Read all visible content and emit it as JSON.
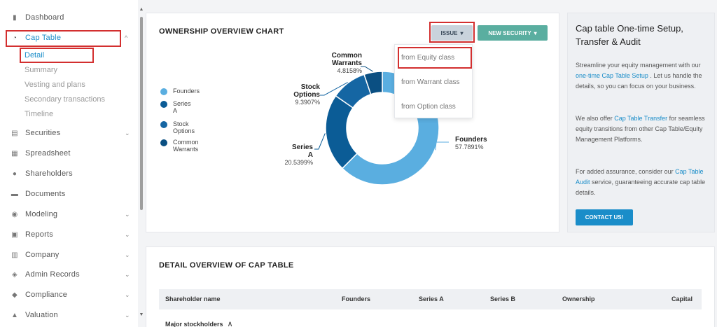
{
  "sidebar": {
    "items": [
      {
        "label": "Dashboard",
        "icon": "dashboard-icon",
        "glyph": "▮"
      },
      {
        "label": "Cap Table",
        "icon": "pie-chart-icon",
        "glyph": "◔",
        "chevron": "^"
      },
      {
        "label": "Securities",
        "icon": "document-icon",
        "glyph": "▤",
        "chevron": "⌄"
      },
      {
        "label": "Spreadsheet",
        "icon": "spreadsheet-icon",
        "glyph": "▦"
      },
      {
        "label": "Shareholders",
        "icon": "person-icon",
        "glyph": "●"
      },
      {
        "label": "Documents",
        "icon": "folder-icon",
        "glyph": "▬"
      },
      {
        "label": "Modeling",
        "icon": "bulb-icon",
        "glyph": "◉",
        "chevron": "⌄"
      },
      {
        "label": "Reports",
        "icon": "report-icon",
        "glyph": "▣",
        "chevron": "⌄"
      },
      {
        "label": "Company",
        "icon": "building-icon",
        "glyph": "▥",
        "chevron": "⌄"
      },
      {
        "label": "Admin Records",
        "icon": "admin-icon",
        "glyph": "◈",
        "chevron": "⌄"
      },
      {
        "label": "Compliance",
        "icon": "shield-icon",
        "glyph": "◆",
        "chevron": "⌄"
      },
      {
        "label": "Valuation",
        "icon": "bar-chart-icon",
        "glyph": "▲",
        "chevron": "⌄"
      }
    ],
    "cap_table_subitems": [
      "Detail",
      "Summary",
      "Vesting and plans",
      "Secondary transactions",
      "Timeline"
    ]
  },
  "chart_card": {
    "title": "OWNERSHIP OVERVIEW CHART",
    "issue_label": "ISSUE",
    "new_security_label": "NEW SECURITY",
    "caret": "▾"
  },
  "dropdown": {
    "items": [
      "from Equity class",
      "from Warrant class",
      "from Option class"
    ]
  },
  "chart_data": {
    "type": "pie",
    "title": "",
    "legend_position": "left",
    "labels": [
      "Founders",
      "Series A",
      "Stock Options",
      "Common Warrants"
    ],
    "values": [
      57.7891,
      20.5399,
      9.3907,
      4.8158
    ],
    "value_labels": [
      "57.7891%",
      "20.5399%",
      "9.3907%",
      "4.8158%"
    ],
    "legend_lines": [
      [
        "Founders"
      ],
      [
        "Series",
        "A"
      ],
      [
        "Stock",
        "Options"
      ],
      [
        "Common",
        "Warrants"
      ]
    ],
    "callout_lines": [
      [
        "Founders"
      ],
      [
        "Series",
        "A"
      ],
      [
        "Stock",
        "Options"
      ],
      [
        "Common",
        "Warrants"
      ]
    ],
    "colors": [
      "#5aaee0",
      "#0b5c96",
      "#1566a3",
      "#0a4f82"
    ]
  },
  "info_card": {
    "title": "Cap table One-time Setup, Transfer & Audit",
    "p1_a": "Streamline your equity management with our ",
    "p1_link": "one-time Cap Table Setup",
    "p1_b": " . Let us handle the details, so you can focus on your business.",
    "p2_a": "We also offer ",
    "p2_link": "Cap Table Transfer",
    "p2_b": " for seamless equity transitions from other Cap Table/Equity Management Platforms.",
    "p3_a": "For added assurance, consider our ",
    "p3_link": "Cap Table Audit",
    "p3_b": " service, guaranteeing accurate cap table details.",
    "contact_label": "CONTACT US!"
  },
  "detail_card": {
    "title": "DETAIL OVERVIEW OF CAP TABLE",
    "columns": [
      "Shareholder name",
      "Founders",
      "Series A",
      "Series B",
      "Ownership",
      "Capital"
    ],
    "group_label": "Major stockholders",
    "group_caret": "∧"
  },
  "colors": {
    "highlight": "#d32f2f",
    "link": "#1a8dc9",
    "accent_teal": "#5aaea0"
  }
}
